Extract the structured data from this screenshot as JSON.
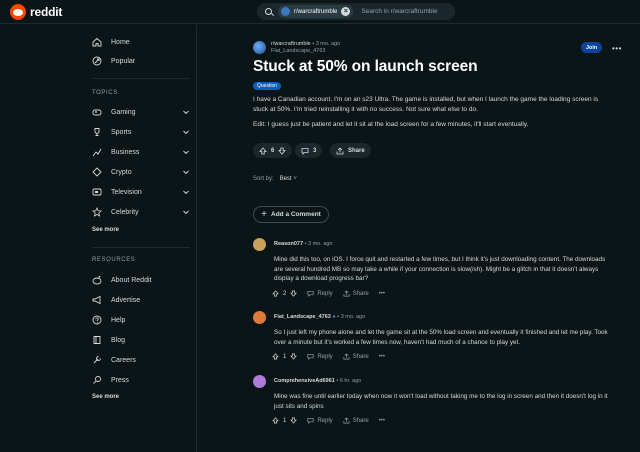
{
  "app": {
    "name": "reddit"
  },
  "search": {
    "chip": "r/warcraftrumble",
    "placeholder": "Search in r/warcraftrumble"
  },
  "sidebar": {
    "home": "Home",
    "popular": "Popular",
    "topics_title": "TOPICS",
    "topics": [
      {
        "label": "Gaming",
        "icon": "gamepad-icon"
      },
      {
        "label": "Sports",
        "icon": "trophy-icon"
      },
      {
        "label": "Business",
        "icon": "chart-icon"
      },
      {
        "label": "Crypto",
        "icon": "crypto-icon"
      },
      {
        "label": "Television",
        "icon": "tv-icon"
      },
      {
        "label": "Celebrity",
        "icon": "star-icon"
      }
    ],
    "see_more_1": "See more",
    "resources_title": "RESOURCES",
    "resources": [
      {
        "label": "About Reddit",
        "icon": "reddit-icon"
      },
      {
        "label": "Advertise",
        "icon": "megaphone-icon"
      },
      {
        "label": "Help",
        "icon": "help-icon"
      },
      {
        "label": "Blog",
        "icon": "book-icon"
      },
      {
        "label": "Careers",
        "icon": "wrench-icon"
      },
      {
        "label": "Press",
        "icon": "mic-icon"
      }
    ],
    "see_more_2": "See more"
  },
  "post": {
    "subreddit": "r/warcraftrumble",
    "time": "• 3 mo. ago",
    "author": "Flat_Landscape_4763",
    "join": "Join",
    "title": "Stuck at 50% on launch screen",
    "flair": "Question",
    "body": "I have a Canadian account. I'm on an s23 Ultra. The game is installed, but when I launch the game the loading screen is stuck at 50%. I'm tried reinstalling it with no success. Not sure what else to do.",
    "edit": "Edit: I guess just be patient and let it sit at the load screen for a few minutes, it'll start eventually.",
    "votes": "6",
    "comments": "3",
    "share": "Share"
  },
  "sort": {
    "label": "Sort by:",
    "value": "Best"
  },
  "add_comment": "Add a Comment",
  "comments": [
    {
      "author": "Reason077",
      "time": "• 3 mo. ago",
      "body": "Mine did this too, on iOS. I force quit and restarted a few times, but I think it's just downloading content. The downloads are several hundred MB so may take a while if your connection is slow(ish). Might be a glitch in that it doesn't always display a download progress bar?",
      "votes": "2",
      "reply": "Reply",
      "share": "Share",
      "avatar_color": "#c9a15a"
    },
    {
      "author": "Flat_Landscape_4763",
      "time": "• 3 mo. ago",
      "body": "So I just left my phone alone and let the game sit at the 50% load screen and eventually it finished and let me play. Took over a minute but it's worked a few times now, haven't had much of a chance to play yet.",
      "votes": "1",
      "reply": "Reply",
      "share": "Share",
      "avatar_color": "#e07a3a"
    },
    {
      "author": "ComprehensiveAd6961",
      "time": "• 6 hr. ago",
      "body": "Mine was fine until earlier today when now it won't load without taking me to the log in screen and then it doesn't log in it just sits and spins",
      "votes": "1",
      "reply": "Reply",
      "share": "Share",
      "avatar_color": "#b07ad8"
    }
  ]
}
